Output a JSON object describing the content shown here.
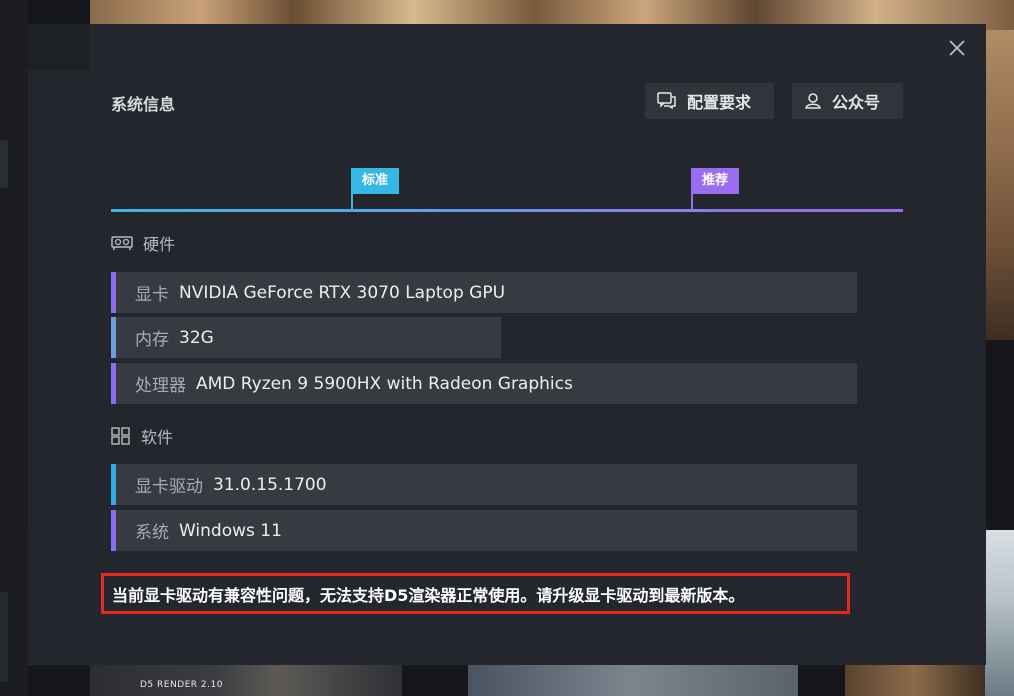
{
  "modal": {
    "title": "系统信息",
    "buttons": {
      "requirements": "配置要求",
      "official_account": "公众号"
    },
    "scale": {
      "standard": "标准",
      "recommended": "推荐"
    },
    "hardware": {
      "heading": "硬件",
      "rows": [
        {
          "label": "显卡",
          "value": "NVIDIA GeForce RTX 3070 Laptop GPU",
          "color": "#8c6cf0"
        },
        {
          "label": "内存",
          "value": "32G",
          "color": "#6aa0e0"
        },
        {
          "label": "处理器",
          "value": "AMD Ryzen 9 5900HX with Radeon Graphics",
          "color": "#8c6cf0"
        }
      ]
    },
    "software": {
      "heading": "软件",
      "rows": [
        {
          "label": "显卡驱动",
          "value": "31.0.15.1700",
          "color": "#35a8e8"
        },
        {
          "label": "系统",
          "value": "Windows 11",
          "color": "#8c6cf0"
        }
      ]
    },
    "warning": "当前显卡驱动有兼容性问题，无法支持D5渲染器正常使用。请升级显卡驱动到最新版本。"
  },
  "background": {
    "card_logo": "D5 RENDER 2.10"
  },
  "colors": {
    "standard": "#35b8e3",
    "recommended": "#9a6cf0",
    "warning_border": "#e8281c"
  }
}
